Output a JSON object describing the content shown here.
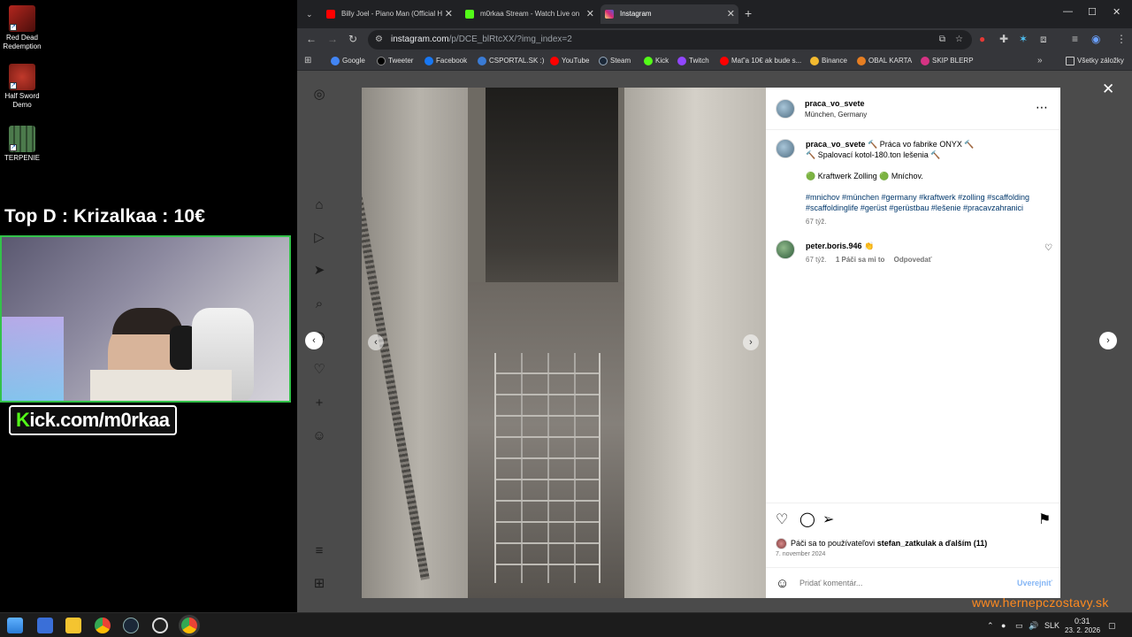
{
  "desktop": {
    "icons": [
      {
        "label_l1": "Red Dead",
        "label_l2": "Redemption"
      },
      {
        "label_l1": "Half Sword",
        "label_l2": "Demo"
      },
      {
        "label_l1": "TERPENIE",
        "label_l2": ""
      }
    ],
    "overlay_title": "Top D : Krizalkaa : 10€",
    "kick_prefix": "K",
    "kick_rest": "ick.com/m0rkaa"
  },
  "browser": {
    "tabs": [
      {
        "title": "Billy Joel - Piano Man (Official H",
        "color": "#ff0000"
      },
      {
        "title": "m0rkaa Stream - Watch Live on",
        "color": "#53fc18"
      },
      {
        "title": "Instagram",
        "color": "#d62976"
      }
    ],
    "url_host": "instagram.com",
    "url_path": "/p/DCE_blRtcXX/?img_index=2",
    "bookmarks": [
      {
        "label": "Google",
        "color": "#4285f4"
      },
      {
        "label": "Tweeter",
        "color": "#000000"
      },
      {
        "label": "Facebook",
        "color": "#1877f2"
      },
      {
        "label": "CSPORTAL.SK :)",
        "color": "#3a7bd5"
      },
      {
        "label": "YouTube",
        "color": "#ff0000"
      },
      {
        "label": "Steam",
        "color": "#1b2838"
      },
      {
        "label": "Kick",
        "color": "#53fc18"
      },
      {
        "label": "Twitch",
        "color": "#9146ff"
      },
      {
        "label": "Mať'a 10€ ak bude s...",
        "color": "#ff0000"
      },
      {
        "label": "Binance",
        "color": "#f3ba2f"
      },
      {
        "label": "OBAL KARTA",
        "color": "#e67e22"
      },
      {
        "label": "SKIP BLERP",
        "color": "#d63384"
      }
    ],
    "all_bookmarks": "Všetky záložky"
  },
  "post": {
    "author": "praca_vo_svete",
    "location": "München, Germany",
    "caption_line1": "🔨 Práca vo fabrike ONYX 🔨",
    "caption_line2": "🔨 Spalovací kotol-180.ton lešenia 🔨",
    "caption_line3": "🟢 Kraftwerk Zolling 🟢 Mníchov.",
    "hashtags_line1": "#mnichov #münchen #germany #kraftwerk #zolling #scaffolding",
    "hashtags_line2": "#scaffoldinglife #gerüst #gerüstbau #lešenie #pracavzahranici",
    "caption_time": "67 týž.",
    "comment": {
      "user": "peter.boris.946",
      "text": "👏",
      "time": "67 týž.",
      "likes": "1 Páči sa mi to",
      "reply": "Odpovedať"
    },
    "likes_prefix": "Páči sa to používateľovi",
    "likes_user": "stefan_zatkulak",
    "likes_suffix": "a ďalším (11)",
    "date": "7. november 2024",
    "comment_placeholder": "Pridať komentár...",
    "publish": "Uverejniť"
  },
  "taskbar": {
    "lang": "SLK",
    "time": "0:31",
    "date": "23. 2. 2026"
  },
  "watermark": "www.hernepczostavy.sk",
  "colors": {
    "kick_green": "#53fc18",
    "link_blue": "#00376b",
    "publish_blue": "#85b6f5",
    "webcam_border": "#33c24a"
  }
}
